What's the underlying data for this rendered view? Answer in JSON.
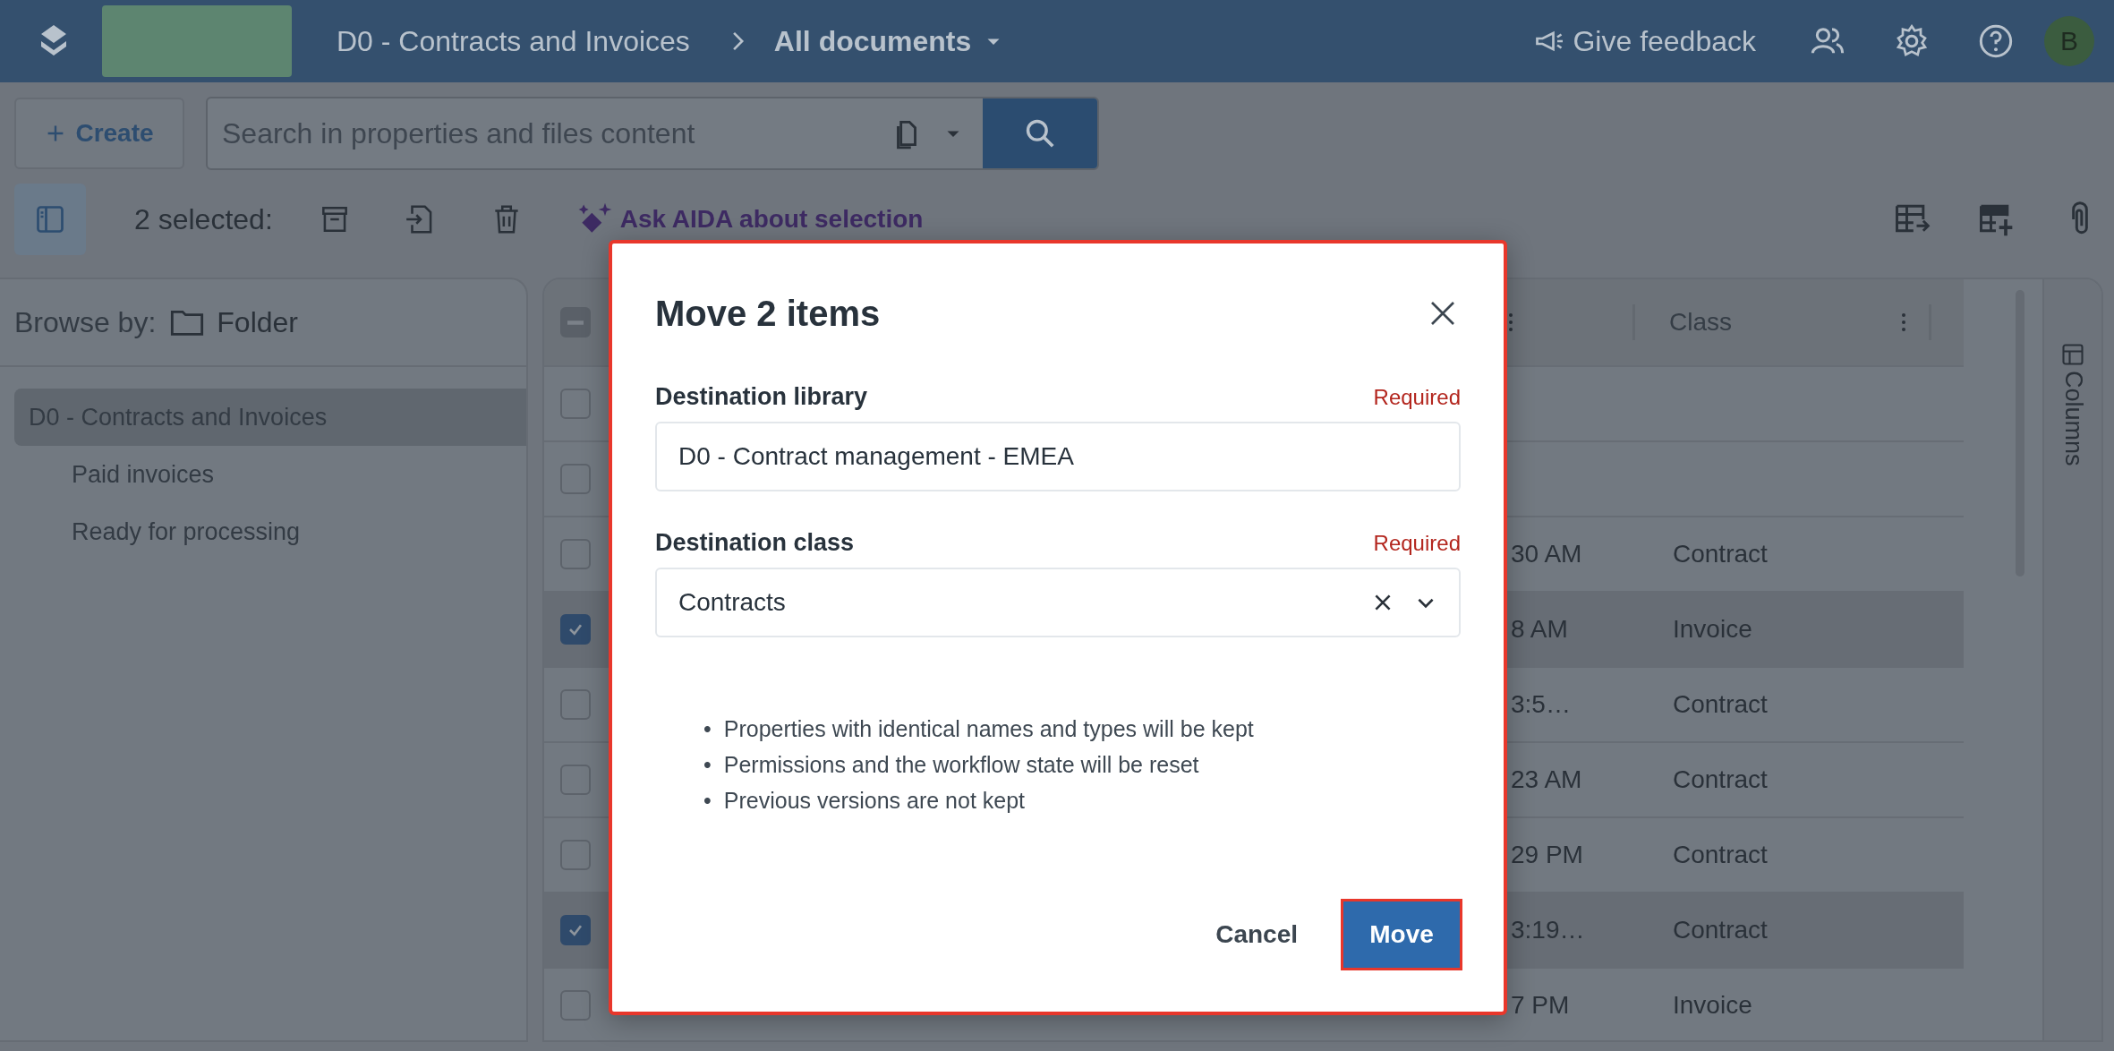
{
  "header": {
    "breadcrumb": "D0 - Contracts and Invoices",
    "view": "All documents",
    "feedback": "Give feedback",
    "avatar": "B"
  },
  "toolbar": {
    "create": "Create",
    "search": {
      "placeholder": "Search in properties and files content"
    },
    "selected_count": "2 selected:",
    "ask": "Ask AIDA about selection"
  },
  "sidebar": {
    "browse_label": "Browse by:",
    "browse_value": "Folder",
    "items": [
      {
        "label": "D0 - Contracts and Invoices",
        "selected": true,
        "children": [
          {
            "label": "Paid invoices",
            "selected": false
          },
          {
            "label": "Ready for processing",
            "selected": false
          }
        ]
      }
    ]
  },
  "table": {
    "header_partial": true,
    "class_column": "Class",
    "columns_panel": "Columns",
    "rows": [
      {
        "selected": false,
        "date": "",
        "class": ""
      },
      {
        "selected": false,
        "date": "",
        "class": ""
      },
      {
        "selected": false,
        "date": "30 AM",
        "class": "Contract"
      },
      {
        "selected": true,
        "date": "8 AM",
        "class": "Invoice"
      },
      {
        "selected": false,
        "date": "3:5…",
        "class": "Contract"
      },
      {
        "selected": false,
        "date": "23 AM",
        "class": "Contract"
      },
      {
        "selected": false,
        "date": "29 PM",
        "class": "Contract"
      },
      {
        "selected": true,
        "date": "3:19…",
        "class": "Contract"
      },
      {
        "selected": false,
        "date": "7 PM",
        "class": "Invoice"
      }
    ]
  },
  "dialog": {
    "title": "Move 2 items",
    "fields": [
      {
        "kind": "text",
        "label": "Destination library",
        "required": "Required",
        "value": "D0 - Contract management - EMEA"
      },
      {
        "kind": "select",
        "label": "Destination class",
        "required": "Required",
        "value": "Contracts"
      }
    ],
    "bullet": "•",
    "notes": [
      "Properties with identical names and types will be kept",
      "Permissions and the workflow state will be reset",
      "Previous versions are not kept"
    ],
    "cancel": "Cancel",
    "confirm": "Move"
  }
}
